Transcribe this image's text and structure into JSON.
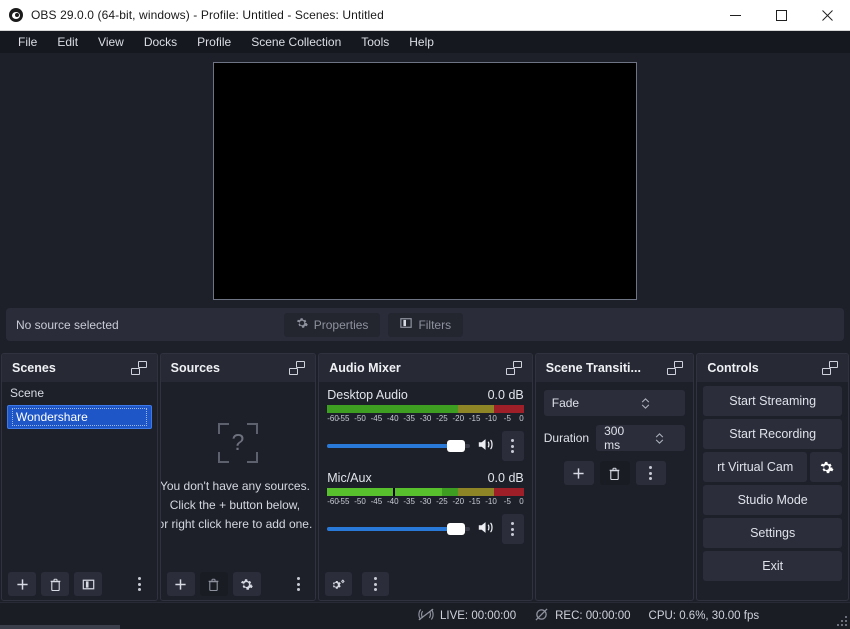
{
  "window": {
    "title": "OBS 29.0.0 (64-bit, windows) - Profile: Untitled - Scenes: Untitled",
    "app_icon": "obs-logo-icon",
    "minimize_label": "—",
    "maximize_label": "□",
    "close_label": "✕"
  },
  "menubar": {
    "items": [
      {
        "label": "File"
      },
      {
        "label": "Edit"
      },
      {
        "label": "View"
      },
      {
        "label": "Docks"
      },
      {
        "label": "Profile"
      },
      {
        "label": "Scene Collection"
      },
      {
        "label": "Tools"
      },
      {
        "label": "Help"
      }
    ]
  },
  "preview": {
    "canvas_color": "#000000"
  },
  "source_toolbar": {
    "status": "No source selected",
    "properties_label": "Properties",
    "filters_label": "Filters"
  },
  "scenes": {
    "title": "Scenes",
    "items": [
      {
        "label": "Scene",
        "selected": false,
        "editing": false
      },
      {
        "label": "Wondershare",
        "selected": true,
        "editing": true
      }
    ],
    "buttons": {
      "add": "+",
      "remove": "trash-icon",
      "filters": "scene-filters-icon",
      "more": "kebab-menu-icon"
    }
  },
  "sources": {
    "title": "Sources",
    "empty_icon": "?",
    "empty_line1": "You don't have any sources.",
    "empty_line2": "Click the + button below,",
    "empty_line3": "or right click here to add one.",
    "buttons": {
      "add": "+",
      "remove": "trash-icon",
      "properties": "gear-icon",
      "more": "kebab-menu-icon"
    }
  },
  "audio_mixer": {
    "title": "Audio Mixer",
    "tracks": [
      {
        "name": "Desktop Audio",
        "db": "0.0 dB",
        "level_db": -60,
        "peak_db": null,
        "volume_percent": 86,
        "muted": false
      },
      {
        "name": "Mic/Aux",
        "db": "0.0 dB",
        "level_db": -25,
        "peak_db": -40,
        "volume_percent": 86,
        "muted": false
      }
    ],
    "scale_ticks": [
      "-60",
      "-55",
      "-50",
      "-45",
      "-40",
      "-35",
      "-30",
      "-25",
      "-20",
      "-15",
      "-10",
      "-5",
      "0"
    ],
    "colors": {
      "green": "#3e9e21",
      "bright_green": "#57c02c",
      "yellow": "#8e8526",
      "red": "#9e1f27"
    },
    "buttons": {
      "advanced_audio": "double-gear-icon",
      "more": "kebab-menu-icon"
    }
  },
  "scene_transitions": {
    "title": "Scene Transiti...",
    "transition": "Fade",
    "duration_label": "Duration",
    "duration_value": "300 ms",
    "buttons": {
      "add": "+",
      "remove": "trash-icon",
      "more": "kebab-menu-icon"
    }
  },
  "controls": {
    "title": "Controls",
    "buttons": [
      {
        "label": "Start Streaming",
        "name": "start-streaming-button"
      },
      {
        "label": "Start Recording",
        "name": "start-recording-button"
      },
      {
        "label": "rt Virtual Cam",
        "name": "start-virtual-cam-button",
        "has_settings": true
      },
      {
        "label": "Studio Mode",
        "name": "studio-mode-button"
      },
      {
        "label": "Settings",
        "name": "settings-button"
      },
      {
        "label": "Exit",
        "name": "exit-button"
      }
    ]
  },
  "statusbar": {
    "live_label": "LIVE: 00:00:00",
    "rec_label": "REC: 00:00:00",
    "cpu_label": "CPU: 0.6%, 30.00 fps"
  }
}
